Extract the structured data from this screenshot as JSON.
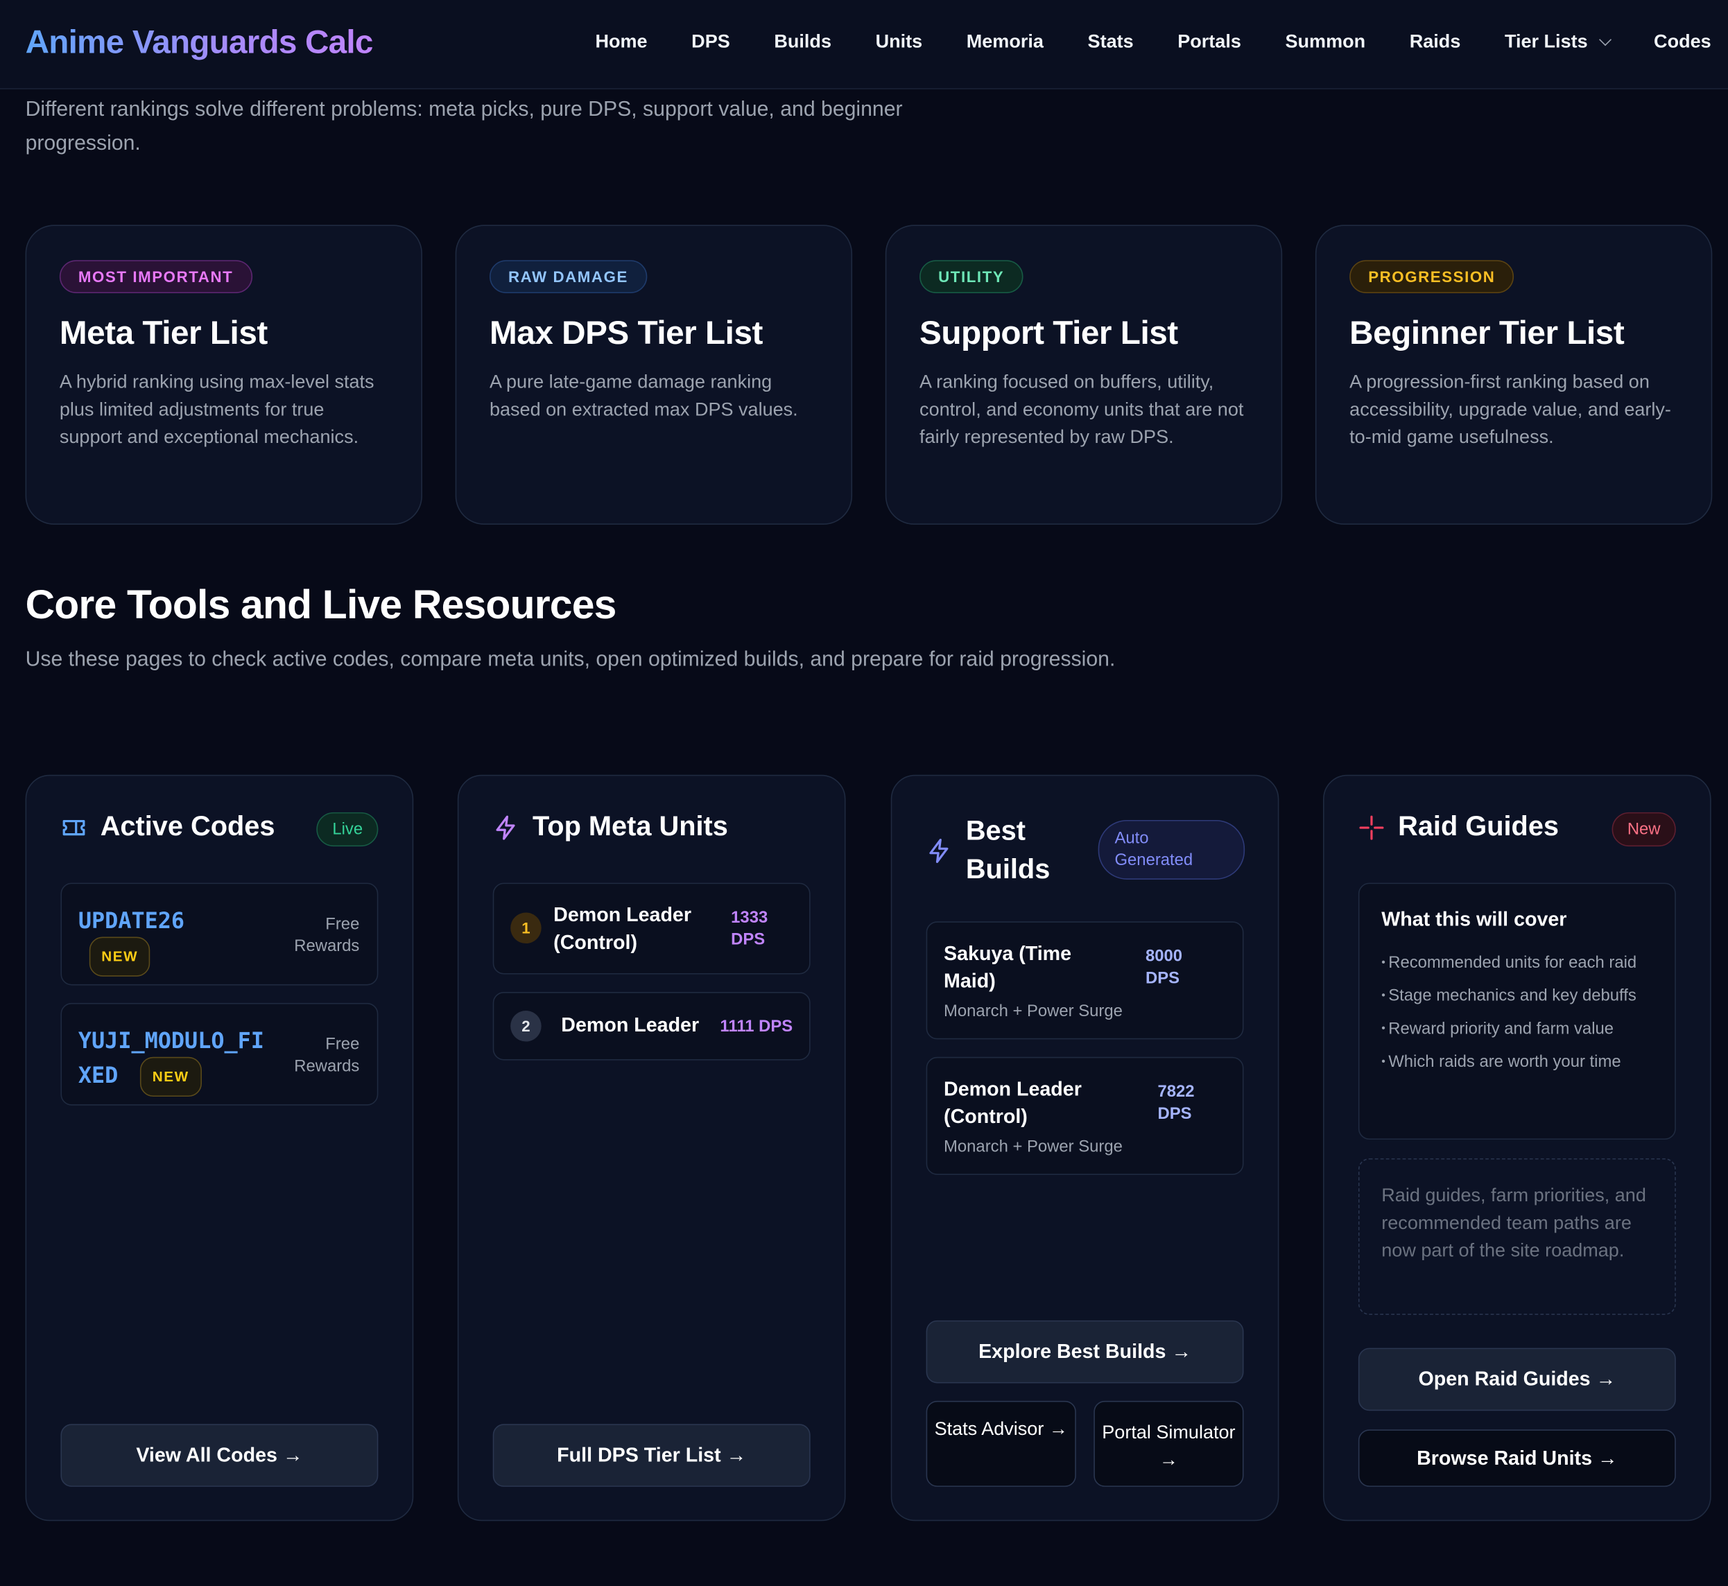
{
  "nav": {
    "brand": "Anime Vanguards Calc",
    "links": [
      "Home",
      "DPS",
      "Builds",
      "Units",
      "Memoria",
      "Stats",
      "Portals",
      "Summon",
      "Raids",
      "Tier Lists",
      "Codes"
    ]
  },
  "intro": "Different rankings solve different problems: meta picks, pure DPS, support value, and beginner progression.",
  "tier_cards": [
    {
      "tag": "MOST IMPORTANT",
      "title": "Meta Tier List",
      "desc": "A hybrid ranking using max-level stats plus limited adjustments for true support and exceptional mechanics.",
      "color": "#e879f9"
    },
    {
      "tag": "RAW DAMAGE",
      "title": "Max DPS Tier List",
      "desc": "A pure late-game damage ranking based on extracted max DPS values.",
      "color": "#93c5fd"
    },
    {
      "tag": "UTILITY",
      "title": "Support Tier List",
      "desc": "A ranking focused on buffers, utility, control, and economy units that are not fairly represented by raw DPS.",
      "color": "#6ee7b7"
    },
    {
      "tag": "PROGRESSION",
      "title": "Beginner Tier List",
      "desc": "A progression-first ranking based on accessibility, upgrade value, and early-to-mid game usefulness.",
      "color": "#fbbf24"
    }
  ],
  "section": {
    "title": "Core Tools and Live Resources",
    "subtitle": "Use these pages to check active codes, compare meta units, open optimized builds, and prepare for raid progression."
  },
  "codes": {
    "title": "Active Codes",
    "badge": "Live",
    "items": [
      {
        "code": "UPDATE26",
        "tag": "NEW",
        "reward_line1": "Free",
        "reward_line2": "Rewards"
      },
      {
        "code_line1": "YUJI_MODULO_FI",
        "code_line2": "XED",
        "tag": "NEW",
        "reward_line1": "Free",
        "reward_line2": "Rewards"
      }
    ],
    "button": "View All Codes →"
  },
  "meta": {
    "title": "Top Meta Units",
    "items": [
      {
        "rank": "1",
        "name_line1": "Demon Leader",
        "name_line2": "(Control)",
        "dps_line1": "1333",
        "dps_line2": "DPS"
      },
      {
        "rank": "2",
        "name": "Demon Leader",
        "dps": "1111 DPS"
      }
    ],
    "button": "Full DPS Tier List →"
  },
  "builds": {
    "title_line1": "Best",
    "title_line2": "Builds",
    "badge_line1": "Auto",
    "badge_line2": "Generated",
    "items": [
      {
        "name_line1": "Sakuya (Time",
        "name_line2": "Maid)",
        "dps_line1": "8000",
        "dps_line2": "DPS",
        "sub": "Monarch + Power Surge"
      },
      {
        "name_line1": "Demon Leader",
        "name_line2": "(Control)",
        "dps_line1": "7822",
        "dps_line2": "DPS",
        "sub": "Monarch + Power Surge"
      }
    ],
    "button": "Explore Best Builds →",
    "sub_buttons": {
      "left": "Stats Advisor →",
      "right_line1": "Portal Simulator",
      "right_line2": "→"
    }
  },
  "raids": {
    "title": "Raid Guides",
    "badge": "New",
    "cover_title": "What this will cover",
    "cover_items": [
      "Recommended units for each raid",
      "Stage mechanics and key debuffs",
      "Reward priority and farm value",
      "Which raids are worth your time"
    ],
    "note": "Raid guides, farm priorities, and recommended team paths are now part of the site roadmap.",
    "button": "Open Raid Guides →",
    "button2": "Browse Raid Units →"
  }
}
